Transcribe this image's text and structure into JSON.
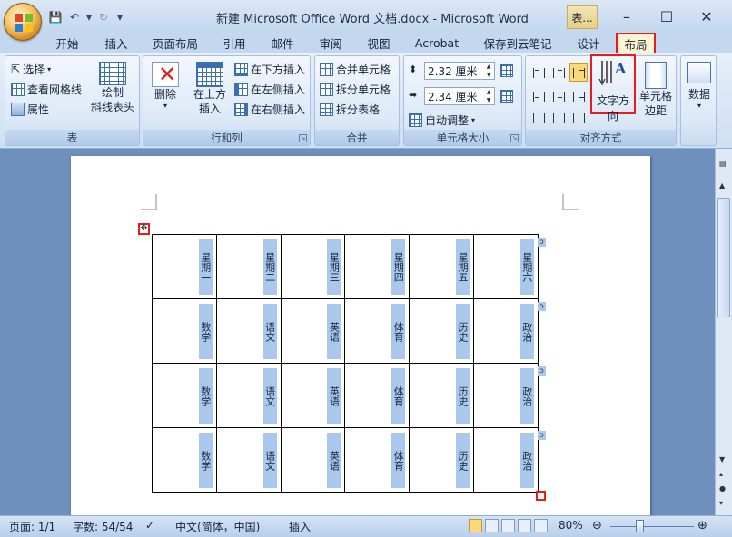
{
  "window": {
    "title": "新建 Microsoft Office Word 文档.docx - Microsoft Word",
    "context_tab": "表...",
    "minimize": "–",
    "maximize": "☐",
    "close": "✕"
  },
  "qat": {
    "save": "💾",
    "undo": "↶",
    "undo_drop": "▾",
    "redo": "↻",
    "customize": "▾"
  },
  "tabs": [
    {
      "label": "开始"
    },
    {
      "label": "插入"
    },
    {
      "label": "页面布局"
    },
    {
      "label": "引用"
    },
    {
      "label": "邮件"
    },
    {
      "label": "审阅"
    },
    {
      "label": "视图"
    },
    {
      "label": "Acrobat"
    },
    {
      "label": "保存到云笔记"
    },
    {
      "label": "设计"
    },
    {
      "label": "布局"
    }
  ],
  "help": "?",
  "ribbon": {
    "table_group": {
      "label": "表",
      "select": "选择",
      "view_gridlines": "查看网格线",
      "properties": "属性",
      "draw_diagonal": "绘制",
      "draw_diagonal_2": "斜线表头"
    },
    "rows_cols_group": {
      "label": "行和列",
      "delete": "删除",
      "insert_above": "在上方",
      "insert_above_2": "插入",
      "insert_below": "在下方插入",
      "insert_left": "在左侧插入",
      "insert_right": "在右侧插入"
    },
    "merge_group": {
      "label": "合并",
      "merge_cells": "合并单元格",
      "split_cells": "拆分单元格",
      "split_table": "拆分表格"
    },
    "cell_size_group": {
      "label": "单元格大小",
      "height": "2.32 厘米",
      "width": "2.34 厘米",
      "autofit": "自动调整"
    },
    "alignment_group": {
      "label": "对齐方式",
      "text_direction": "文字方向",
      "cell_margins": "单元格",
      "cell_margins_2": "边距"
    },
    "data_group": {
      "label": "数据"
    }
  },
  "table": {
    "header_row": [
      "星期一",
      "星期二",
      "星期三",
      "星期四",
      "星期五",
      "星期六"
    ],
    "rows": [
      [
        "数学",
        "语文",
        "英语",
        "体育",
        "历史",
        "政治"
      ],
      [
        "数学",
        "语文",
        "英语",
        "体育",
        "历史",
        "政治"
      ],
      [
        "数学",
        "语文",
        "英语",
        "体育",
        "历史",
        "政治"
      ]
    ],
    "cell_end_mark": "ↄ",
    "row_end_mark": "ↄ"
  },
  "status": {
    "page": "页面: 1/1",
    "words": "字数: 54/54",
    "language": "中文(简体，中国)",
    "mode": "插入",
    "zoom": "80%",
    "zoom_level_percent": 80
  }
}
